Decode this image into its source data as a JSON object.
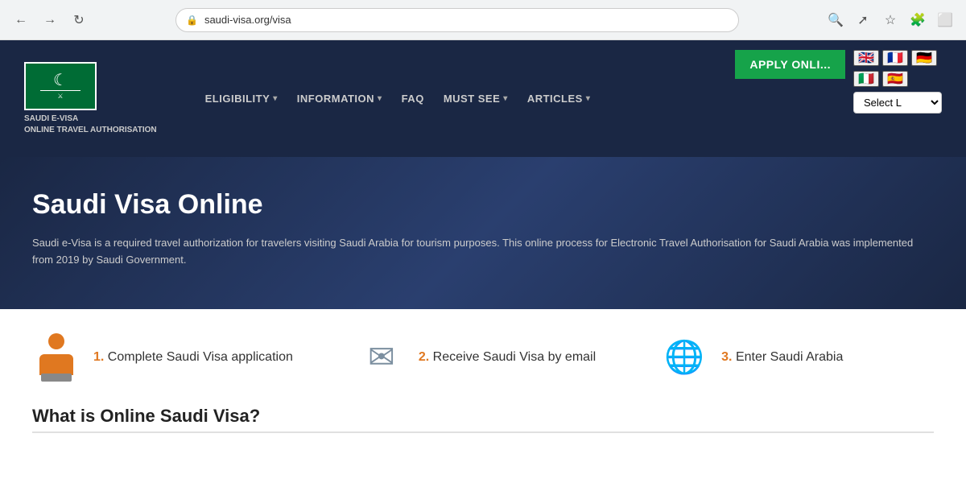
{
  "browser": {
    "url": "saudi-visa.org/visa",
    "back_label": "←",
    "forward_label": "→",
    "reload_label": "↻"
  },
  "header": {
    "logo_text_line1": "SAUDI E-VISA",
    "logo_text_line2": "ONLINE TRAVEL AUTHORISATION",
    "nav": [
      {
        "label": "ELIGIBILITY",
        "has_arrow": true
      },
      {
        "label": "INFORMATION",
        "has_arrow": true
      },
      {
        "label": "FAQ",
        "has_arrow": false
      },
      {
        "label": "MUST SEE",
        "has_arrow": true
      },
      {
        "label": "ARTICLES",
        "has_arrow": true
      }
    ],
    "apply_btn": "APPLY ONLI...",
    "language_placeholder": "Select L",
    "flags": [
      "🇬🇧",
      "🇫🇷",
      "🇩🇪",
      "🇮🇹",
      "🇪🇸"
    ]
  },
  "hero": {
    "title": "Saudi Visa Online",
    "description": "Saudi e-Visa is a required travel authorization for travelers visiting Saudi Arabia for tourism purposes. This online process for Electronic Travel Authorisation for Saudi Arabia was implemented from 2019 by Saudi Government."
  },
  "steps": [
    {
      "number": "1.",
      "label": "Complete Saudi Visa application",
      "icon_type": "person"
    },
    {
      "number": "2.",
      "label": "Receive Saudi Visa by email",
      "icon_type": "envelope"
    },
    {
      "number": "3.",
      "label": "Enter Saudi Arabia",
      "icon_type": "passport"
    }
  ],
  "what_section": {
    "title": "What is Online Saudi Visa?"
  }
}
